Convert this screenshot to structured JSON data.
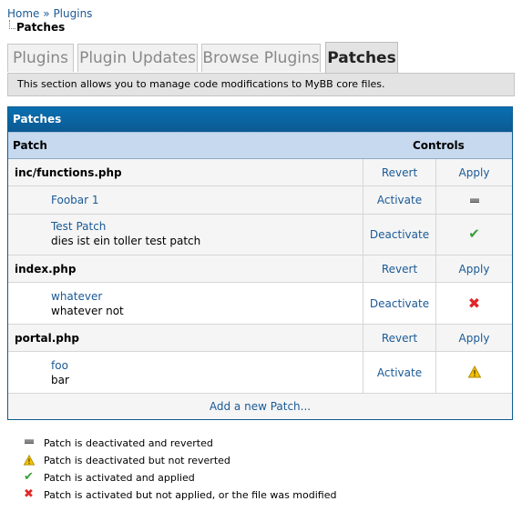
{
  "breadcrumb": {
    "home": "Home",
    "separator": "»",
    "plugins": "Plugins",
    "current": "Patches"
  },
  "tabs": [
    {
      "label": "Plugins",
      "active": false
    },
    {
      "label": "Plugin Updates",
      "active": false
    },
    {
      "label": "Browse Plugins",
      "active": false
    },
    {
      "label": "Patches",
      "active": true
    }
  ],
  "description": "This section allows you to manage code modifications to MyBB core files.",
  "table": {
    "title": "Patches",
    "col_patch": "Patch",
    "col_controls": "Controls",
    "files": [
      {
        "name": "inc/functions.php",
        "revert": "Revert",
        "apply": "Apply",
        "patches": [
          {
            "title": "Foobar 1",
            "desc": "",
            "action": "Activate",
            "status_icon": "deactivated-reverted-icon"
          },
          {
            "title": "Test Patch",
            "desc": "dies ist ein toller test patch",
            "action": "Deactivate",
            "status_icon": "check-icon"
          }
        ]
      },
      {
        "name": "index.php",
        "revert": "Revert",
        "apply": "Apply",
        "patches": [
          {
            "title": "whatever",
            "desc": "whatever not",
            "action": "Deactivate",
            "status_icon": "cross-icon"
          }
        ]
      },
      {
        "name": "portal.php",
        "revert": "Revert",
        "apply": "Apply",
        "patches": [
          {
            "title": "foo",
            "desc": "bar",
            "action": "Activate",
            "status_icon": "warning-icon"
          }
        ]
      }
    ],
    "add_link": "Add a new Patch..."
  },
  "legend": [
    {
      "icon": "deactivated-reverted-icon",
      "text": "Patch is deactivated and reverted"
    },
    {
      "icon": "warning-icon",
      "text": "Patch is deactivated but not reverted"
    },
    {
      "icon": "check-icon",
      "text": "Patch is activated and applied"
    },
    {
      "icon": "cross-icon",
      "text": "Patch is activated but not applied, or the file was modified"
    }
  ],
  "colors": {
    "header_blue": "#0b6aa9",
    "link": "#1a5a96",
    "check": "#3aa03a",
    "cross": "#e02828",
    "warning": "#f2c200"
  }
}
